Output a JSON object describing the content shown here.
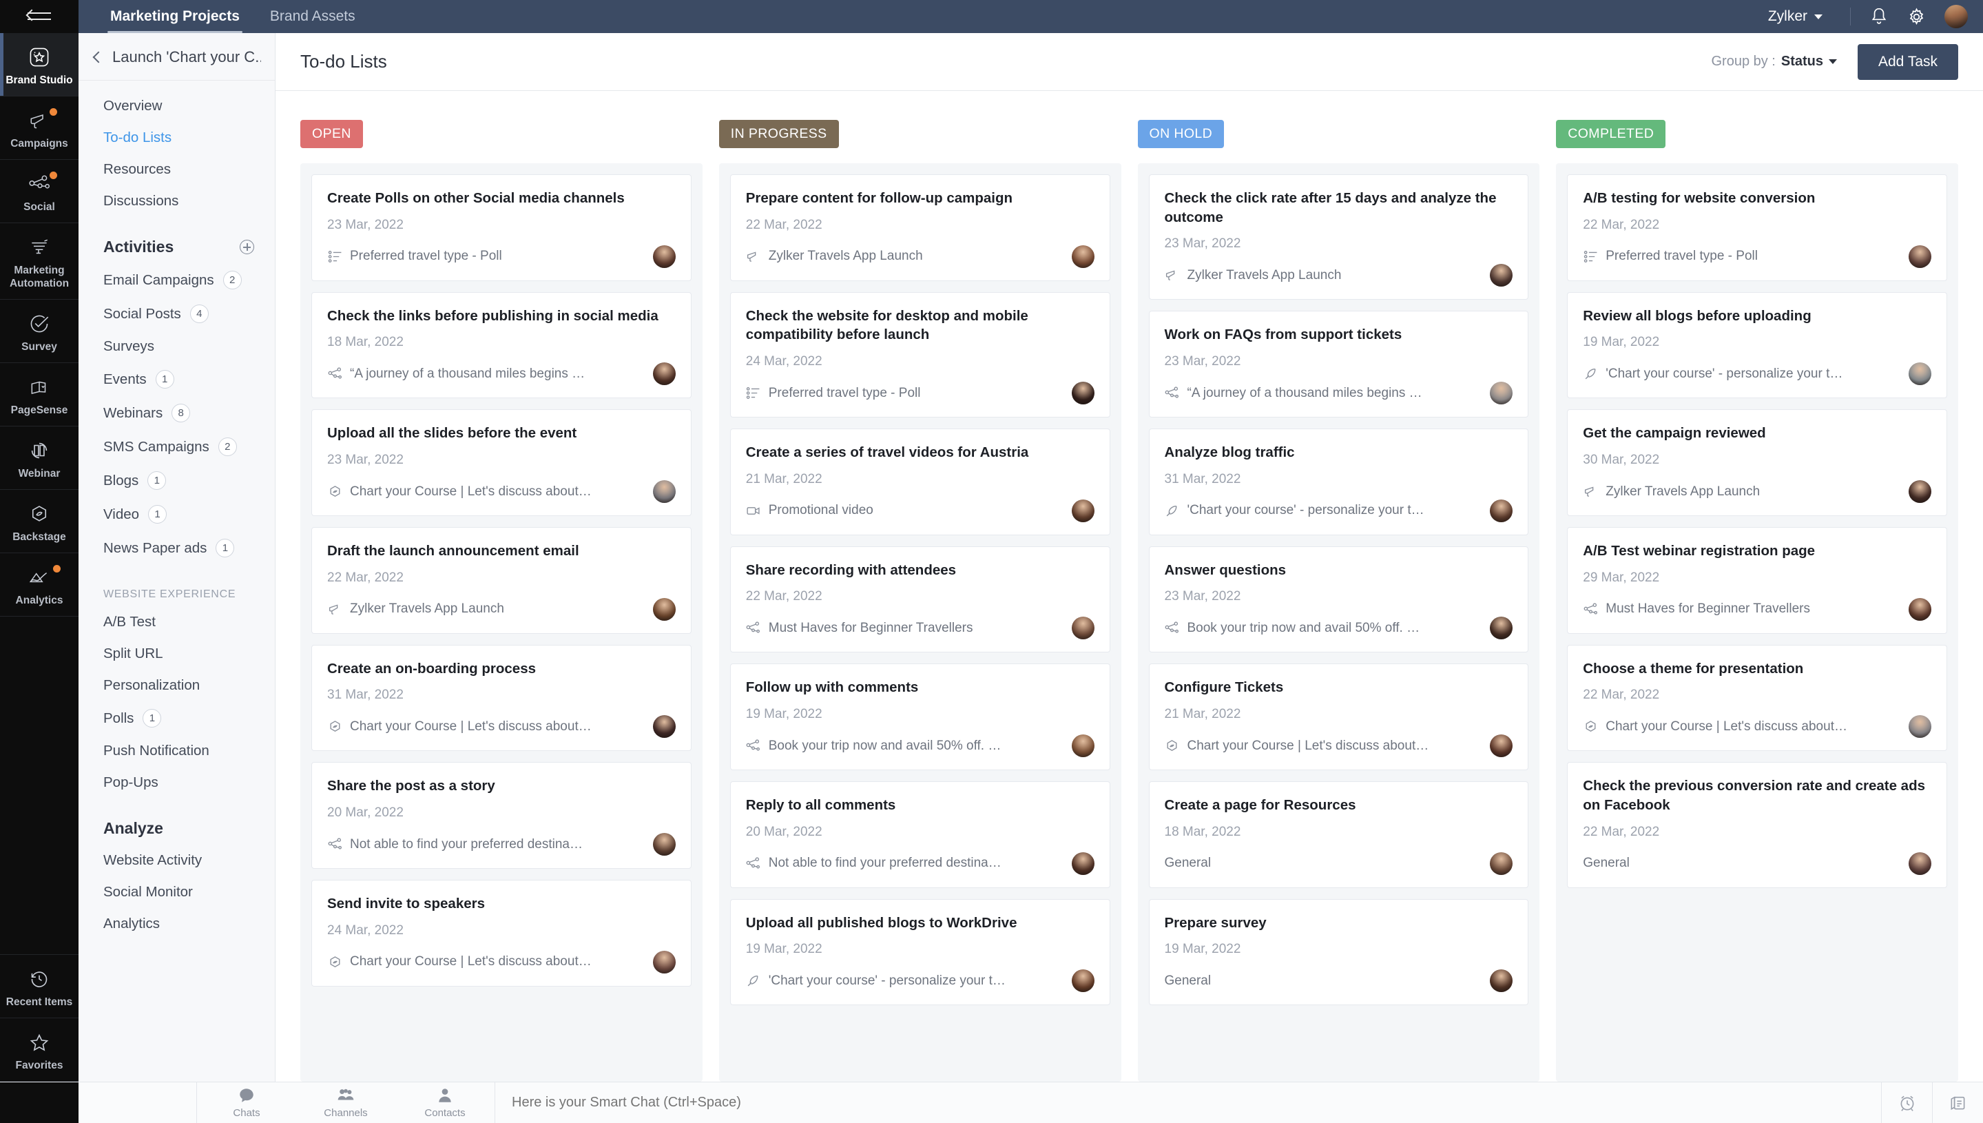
{
  "topbar": {
    "collapse_icon": "collapse-arrow-icon",
    "tabs": [
      {
        "label": "Marketing Projects",
        "active": true
      },
      {
        "label": "Brand Assets",
        "active": false
      }
    ],
    "org": "Zylker",
    "icons": [
      "bell-icon",
      "gear-icon",
      "user-avatar"
    ]
  },
  "rail": {
    "items": [
      {
        "label": "Brand Studio",
        "icon": "brand-studio-icon",
        "active": true,
        "dot": false
      },
      {
        "label": "Campaigns",
        "icon": "megaphone-icon",
        "active": false,
        "dot": true
      },
      {
        "label": "Social",
        "icon": "social-network-icon",
        "active": false,
        "dot": true
      },
      {
        "label": "Marketing Automation",
        "icon": "automation-icon",
        "active": false,
        "dot": false
      },
      {
        "label": "Survey",
        "icon": "check-circle-icon",
        "active": false,
        "dot": false
      },
      {
        "label": "PageSense",
        "icon": "pages-icon",
        "active": false,
        "dot": false
      },
      {
        "label": "Webinar",
        "icon": "webinar-icon",
        "active": false,
        "dot": false
      },
      {
        "label": "Backstage",
        "icon": "backstage-icon",
        "active": false,
        "dot": false
      },
      {
        "label": "Analytics",
        "icon": "analytics-icon",
        "active": false,
        "dot": true
      }
    ],
    "bottom": [
      {
        "label": "Recent Items",
        "icon": "clock-history-icon"
      },
      {
        "label": "Favorites",
        "icon": "star-icon"
      }
    ]
  },
  "projnav": {
    "back_icon": "chevron-left-icon",
    "project_title": "Launch 'Chart your C...",
    "links": [
      {
        "label": "Overview",
        "active": false
      },
      {
        "label": "To-do Lists",
        "active": true
      },
      {
        "label": "Resources",
        "active": false
      },
      {
        "label": "Discussions",
        "active": false
      }
    ],
    "activities_heading": "Activities",
    "add_activity_icon": "plus-circle-icon",
    "activities": [
      {
        "label": "Email Campaigns",
        "count": "2"
      },
      {
        "label": "Social Posts",
        "count": "4"
      },
      {
        "label": "Surveys",
        "count": ""
      },
      {
        "label": "Events",
        "count": "1"
      },
      {
        "label": "Webinars",
        "count": "8"
      },
      {
        "label": "SMS Campaigns",
        "count": "2"
      },
      {
        "label": "Blogs",
        "count": "1"
      },
      {
        "label": "Video",
        "count": "1"
      },
      {
        "label": "News Paper ads",
        "count": "1"
      }
    ],
    "website_experience_heading": "WEBSITE EXPERIENCE",
    "website_experience": [
      {
        "label": "A/B Test"
      },
      {
        "label": "Split URL"
      },
      {
        "label": "Personalization"
      },
      {
        "label": "Polls",
        "count": "1"
      },
      {
        "label": "Push Notification"
      },
      {
        "label": "Pop-Ups"
      }
    ],
    "analyze_heading": "Analyze",
    "analyze": [
      {
        "label": "Website Activity"
      },
      {
        "label": "Social Monitor"
      },
      {
        "label": "Analytics"
      }
    ]
  },
  "main": {
    "page_title": "To-do Lists",
    "group_by_label": "Group by :",
    "group_by_value": "Status",
    "add_task_label": "Add Task"
  },
  "board": {
    "columns": [
      {
        "status": "OPEN",
        "color": "#dd7070",
        "cards": [
          {
            "title": "Create Polls on other Social media channels",
            "date": "23 Mar, 2022",
            "meta": "Preferred travel type - Poll",
            "icon": "poll-icon",
            "avatar": "#6d4435"
          },
          {
            "title": "Check the links before publishing in social media",
            "date": "18 Mar, 2022",
            "meta": "“A journey of a thousand miles begins …",
            "icon": "share-icon",
            "avatar": "#5e3a2d"
          },
          {
            "title": "Upload all the slides before the event",
            "date": "23 Mar, 2022",
            "meta": "Chart your Course | Let's discuss about…",
            "icon": "backstage-icon",
            "avatar": "#8d8a8f"
          },
          {
            "title": "Draft the launch announcement email",
            "date": "22 Mar, 2022",
            "meta": "Zylker Travels App Launch",
            "icon": "megaphone-icon",
            "avatar": "#7a4e32"
          },
          {
            "title": "Create an on-boarding process",
            "date": "31 Mar, 2022",
            "meta": "Chart your Course | Let's discuss about…",
            "icon": "backstage-icon",
            "avatar": "#4a2f2c"
          },
          {
            "title": "Share the post as a story",
            "date": "20 Mar, 2022",
            "meta": "Not able to find your preferred destina…",
            "icon": "share-icon",
            "avatar": "#6b4a3a"
          },
          {
            "title": "Send invite to speakers",
            "date": "24 Mar, 2022",
            "meta": "Chart your Course | Let's discuss about…",
            "icon": "backstage-icon",
            "avatar": "#7c5348"
          }
        ]
      },
      {
        "status": "IN PROGRESS",
        "color": "#7a6a54",
        "cards": [
          {
            "title": "Prepare content for follow-up campaign",
            "date": "22 Mar, 2022",
            "meta": "Zylker Travels App Launch",
            "icon": "megaphone-icon",
            "avatar": "#87543a"
          },
          {
            "title": "Check the website for desktop and mobile compatibility before launch",
            "date": "24 Mar, 2022",
            "meta": "Preferred travel type - Poll",
            "icon": "poll-icon",
            "avatar": "#3a2520"
          },
          {
            "title": "Create a series of travel videos for Austria",
            "date": "21 Mar, 2022",
            "meta": "Promotional video",
            "icon": "video-icon",
            "avatar": "#6f4733"
          },
          {
            "title": "Share recording with attendees",
            "date": "22 Mar, 2022",
            "meta": "Must Haves for Beginner Travellers",
            "icon": "share-icon",
            "avatar": "#7d5440"
          },
          {
            "title": "Follow up with comments",
            "date": "19 Mar, 2022",
            "meta": "Book your trip now and avail 50% off. …",
            "icon": "share-icon",
            "avatar": "#8a5a3c"
          },
          {
            "title": "Reply to all comments",
            "date": "20 Mar, 2022",
            "meta": "Not able to find your preferred destina…",
            "icon": "share-icon",
            "avatar": "#5d3a2c"
          },
          {
            "title": "Upload all published blogs to WorkDrive",
            "date": "19 Mar, 2022",
            "meta": "'Chart your course' - personalize your t…",
            "icon": "feather-icon",
            "avatar": "#74462f"
          }
        ]
      },
      {
        "status": "ON HOLD",
        "color": "#6ba4e8",
        "cards": [
          {
            "title": "Check the click rate after 15 days and analyze the outcome",
            "date": "23 Mar, 2022",
            "meta": "Zylker Travels App Launch",
            "icon": "megaphone-icon",
            "avatar": "#5a4038"
          },
          {
            "title": "Work on FAQs from support tickets",
            "date": "23 Mar, 2022",
            "meta": "“A journey of a thousand miles begins …",
            "icon": "share-icon",
            "avatar": "#a5a0a0"
          },
          {
            "title": "Analyze blog traffic",
            "date": "31 Mar, 2022",
            "meta": "'Chart your course' - personalize your t…",
            "icon": "feather-icon",
            "avatar": "#6a4433"
          },
          {
            "title": "Answer questions",
            "date": "23 Mar, 2022",
            "meta": "Book your trip now and avail 50% off. …",
            "icon": "share-icon",
            "avatar": "#4e3328"
          },
          {
            "title": "Configure Tickets",
            "date": "21 Mar, 2022",
            "meta": "Chart your Course | Let's discuss about…",
            "icon": "backstage-icon",
            "avatar": "#6a3f30"
          },
          {
            "title": "Create a page for Resources",
            "date": "18 Mar, 2022",
            "meta": "General",
            "icon": "",
            "avatar": "#7a5542"
          },
          {
            "title": "Prepare survey",
            "date": "19 Mar, 2022",
            "meta": "General",
            "icon": "",
            "avatar": "#5c3a2b"
          }
        ]
      },
      {
        "status": "COMPLETED",
        "color": "#64b97c",
        "cards": [
          {
            "title": "A/B testing for website conversion",
            "date": "22 Mar, 2022",
            "meta": "Preferred travel type - Poll",
            "icon": "poll-icon",
            "avatar": "#6d4a42"
          },
          {
            "title": "Review all blogs before uploading",
            "date": "19 Mar, 2022",
            "meta": "'Chart your course' - personalize your t…",
            "icon": "feather-icon",
            "avatar": "#9aa0a4"
          },
          {
            "title": "Get the campaign reviewed",
            "date": "30 Mar, 2022",
            "meta": "Zylker Travels App Launch",
            "icon": "megaphone-icon",
            "avatar": "#4d322b"
          },
          {
            "title": "A/B Test webinar registration page",
            "date": "29 Mar, 2022",
            "meta": "Must Haves for Beginner Travellers",
            "icon": "share-icon",
            "avatar": "#6b4132"
          },
          {
            "title": "Choose a theme for presentation",
            "date": "22 Mar, 2022",
            "meta": "Chart your Course | Let's discuss about…",
            "icon": "backstage-icon",
            "avatar": "#9d9a9e"
          },
          {
            "title": "Check the previous conversion rate and create ads on Facebook",
            "date": "22 Mar, 2022",
            "meta": "General",
            "icon": "",
            "avatar": "#6c4a45"
          }
        ]
      }
    ]
  },
  "bottombar": {
    "items": [
      {
        "label": "Chats",
        "icon": "chat-bubble-icon"
      },
      {
        "label": "Channels",
        "icon": "group-icon"
      },
      {
        "label": "Contacts",
        "icon": "person-icon"
      }
    ],
    "search_placeholder": "Here is your Smart Chat (Ctrl+Space)",
    "right_icons": [
      "alarm-clock-icon",
      "notes-stack-icon"
    ]
  }
}
